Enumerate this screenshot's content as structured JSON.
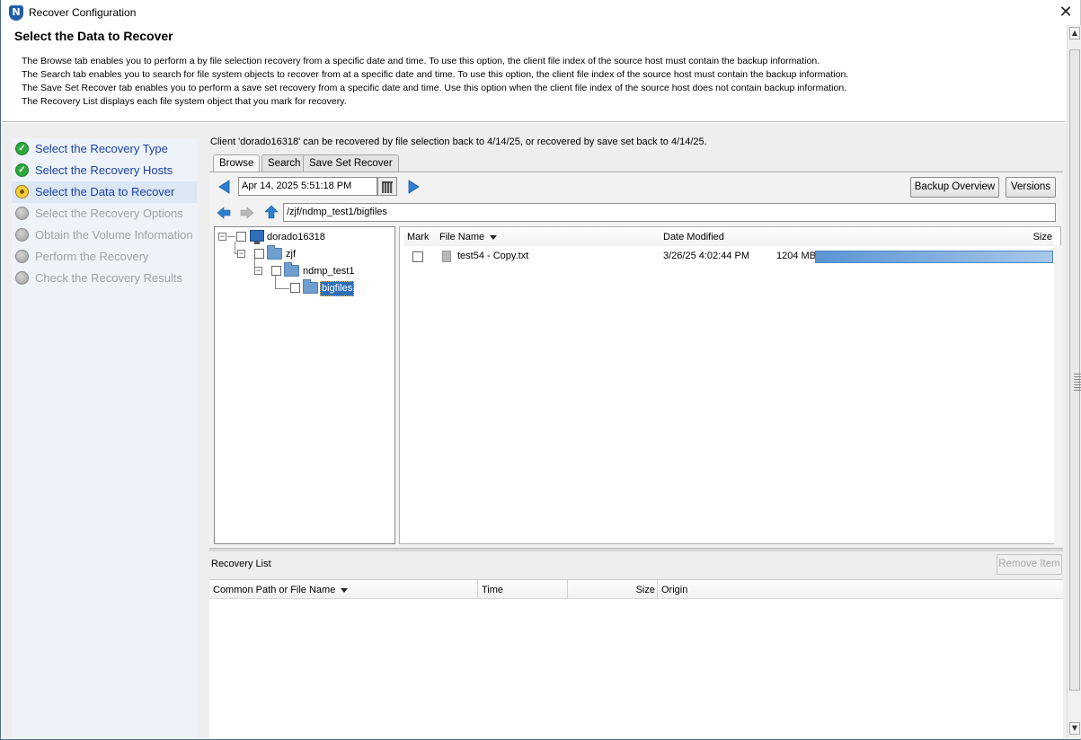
{
  "window": {
    "title": "Recover Configuration",
    "app_icon_letter": "N"
  },
  "header": {
    "title": "Select the Data to Recover",
    "lines": [
      "The Browse tab enables you to perform a by file selection recovery from a specific date and time. To use this option, the client file index of the source host must contain the backup information.",
      "The Search tab enables you to search for file system objects to recover from at a specific date and time. To use this option, the client file index of the source host must contain the backup information.",
      "The Save Set Recover tab enables you to perform a save set recovery from a specific date and time.  Use this option when the client file index of the source host does not contain backup information.",
      "The Recovery List displays each file system object that you mark for recovery."
    ]
  },
  "steps": [
    {
      "label": "Select the Recovery Type",
      "state": "done"
    },
    {
      "label": "Select the Recovery Hosts",
      "state": "done"
    },
    {
      "label": "Select the Data to Recover",
      "state": "current"
    },
    {
      "label": "Select the Recovery Options",
      "state": "pending"
    },
    {
      "label": "Obtain the Volume Information",
      "state": "pending"
    },
    {
      "label": "Perform the Recovery",
      "state": "pending"
    },
    {
      "label": "Check the Recovery Results",
      "state": "pending"
    }
  ],
  "client_info": "Client 'dorado16318' can be recovered by file selection back to 4/14/25, or recovered by save set back to 4/14/25.",
  "tabs": [
    {
      "label": "Browse",
      "active": true
    },
    {
      "label": "Search",
      "active": false
    },
    {
      "label": "Save Set Recover",
      "active": false
    }
  ],
  "browse": {
    "date_value": "Apr 14, 2025 5:51:18 PM",
    "backup_overview_label": "Backup Overview",
    "versions_label": "Versions",
    "path_value": "/zjf/ndmp_test1/bigfiles",
    "tree": [
      {
        "label": "dorado16318",
        "icon": "computer-icon",
        "expander": "−"
      },
      {
        "label": "zjf",
        "icon": "folder-icon",
        "expander": "−"
      },
      {
        "label": "ndmp_test1",
        "icon": "folder-icon",
        "expander": "−"
      },
      {
        "label": "bigfiles",
        "icon": "folder-icon",
        "selected": true
      }
    ],
    "columns": {
      "mark": "Mark",
      "file_name": "File Name",
      "date_modified": "Date Modified",
      "size": "Size"
    },
    "rows": [
      {
        "file_name": "test54 - Copy.txt",
        "date_modified": "3/26/25 4:02:44 PM",
        "size": "1204 MB",
        "size_fraction": 1.0
      }
    ]
  },
  "recovery_list": {
    "label": "Recovery List",
    "remove_item_label": "Remove Item",
    "columns": {
      "path": "Common Path or File Name",
      "time": "Time",
      "size": "Size",
      "origin": "Origin"
    },
    "rows": []
  },
  "colors": {
    "accent": "#2f6fb8",
    "step_active_text": "#1b3fa8",
    "step_pending_text": "#9aa2ac",
    "done_green": "#2da83a",
    "current_yellow": "#f6cf3e"
  }
}
